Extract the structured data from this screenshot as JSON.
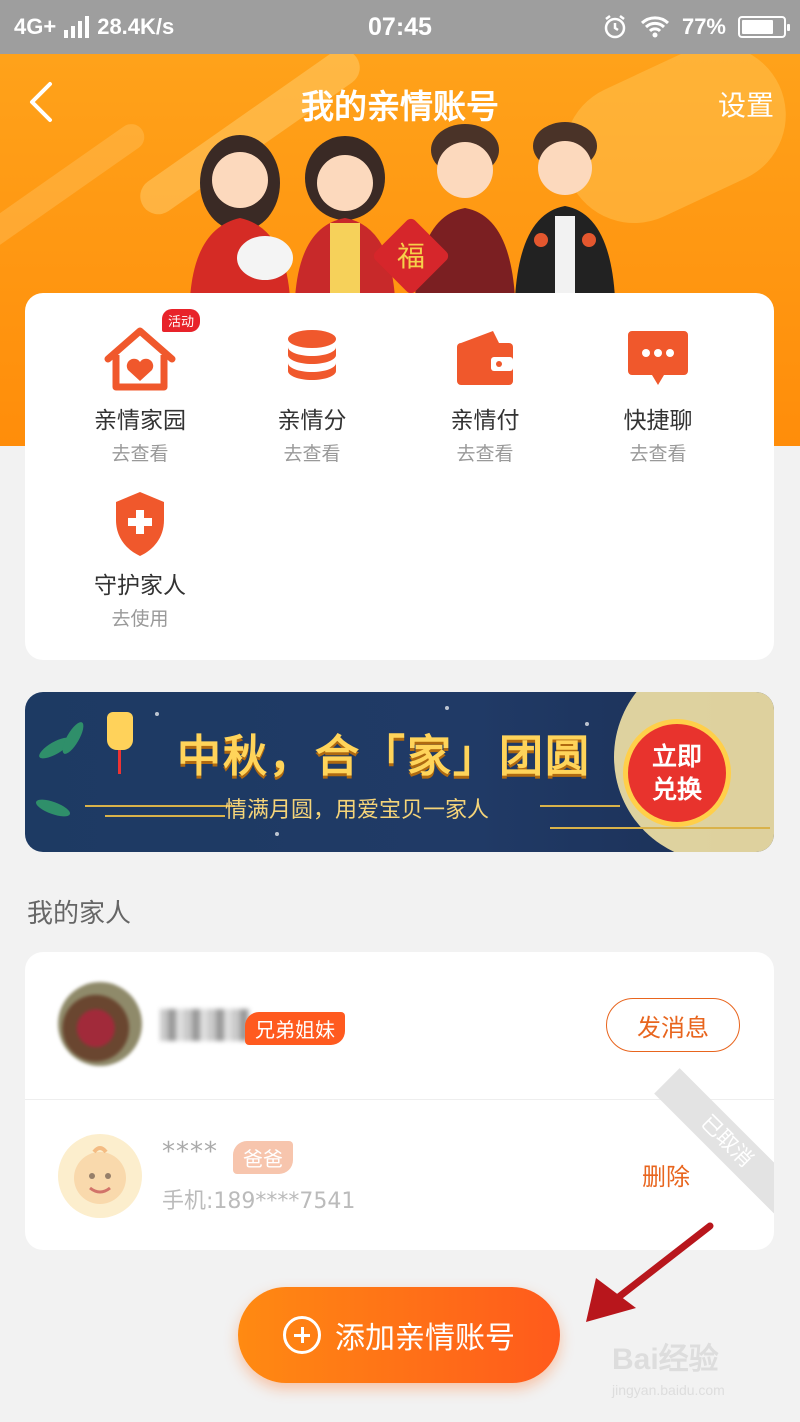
{
  "status_bar": {
    "network": "4G+",
    "speed": "28.4K/s",
    "time": "07:45",
    "battery": "77%",
    "battery_level": 0.77
  },
  "header": {
    "title": "我的亲情账号",
    "settings_label": "设置"
  },
  "features": [
    {
      "name": "亲情家园",
      "sub": "去查看",
      "icon": "home-heart-icon",
      "badge": "活动"
    },
    {
      "name": "亲情分",
      "sub": "去查看",
      "icon": "coins-stack-icon"
    },
    {
      "name": "亲情付",
      "sub": "去查看",
      "icon": "wallet-icon"
    },
    {
      "name": "快捷聊",
      "sub": "去查看",
      "icon": "chat-bubble-icon"
    },
    {
      "name": "守护家人",
      "sub": "去使用",
      "icon": "shield-plus-icon"
    }
  ],
  "banner": {
    "headline": "中秋，合「家」团圆",
    "subline": "情满月圆，用爱宝贝一家人",
    "cta": "立即兑换"
  },
  "family_section": {
    "title": "我的家人",
    "members": [
      {
        "relation": "兄弟姐妹",
        "action": "发消息"
      },
      {
        "name_masked": "****",
        "relation": "爸爸",
        "phone": "手机:189****7541",
        "action": "删除",
        "status": "已取消"
      }
    ]
  },
  "add_button": {
    "label": "添加亲情账号"
  },
  "watermark": {
    "text": "Bai经验",
    "sub": "jingyan.baidu.com"
  },
  "colors": {
    "brand_orange": "#ff8d0a",
    "accent": "#e8651e",
    "badge_red": "#e8232a"
  }
}
